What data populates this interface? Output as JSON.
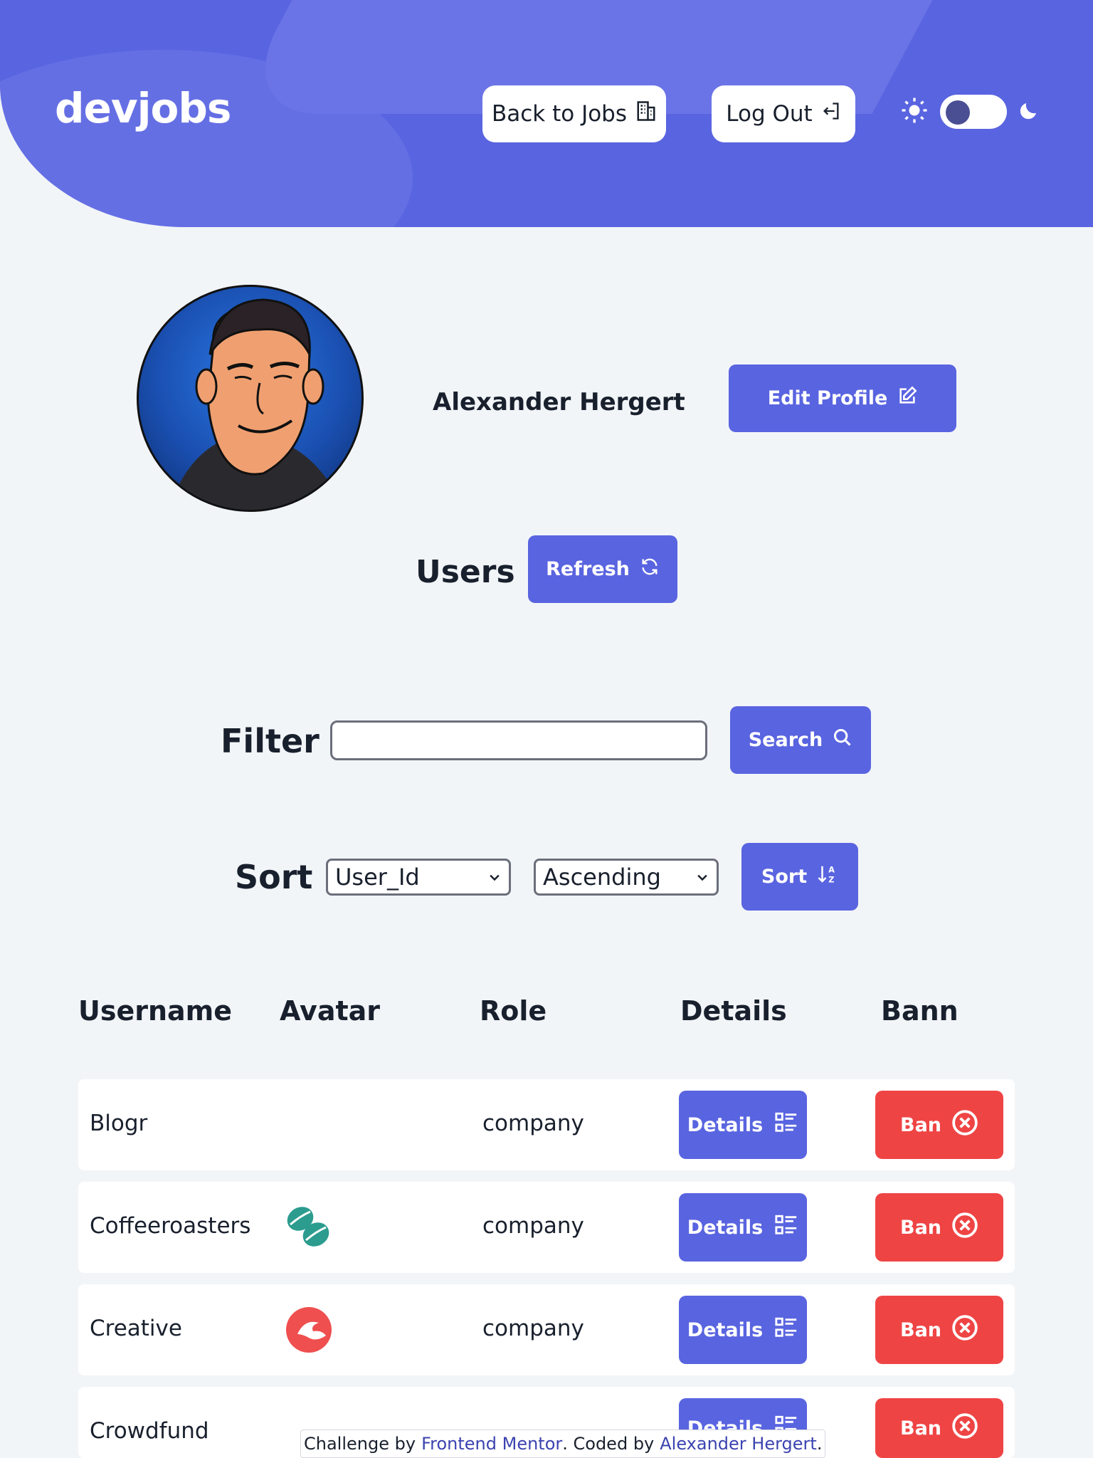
{
  "app": {
    "logo": "devjobs"
  },
  "header": {
    "back_label": "Back to Jobs",
    "back_icon": "building-icon",
    "logout_label": "Log Out",
    "logout_icon": "logout-icon",
    "theme_toggle": {
      "light_icon": "sun-icon",
      "dark_icon": "moon-icon",
      "state": "light"
    }
  },
  "profile": {
    "name": "Alexander Hergert",
    "edit_label": "Edit Profile"
  },
  "users": {
    "title": "Users",
    "refresh_label": "Refresh"
  },
  "filter": {
    "label": "Filter",
    "value": "",
    "search_label": "Search"
  },
  "sort": {
    "label": "Sort",
    "field": "User_Id",
    "direction": "Ascending",
    "button_label": "Sort"
  },
  "table": {
    "headers": [
      "Username",
      "Avatar",
      "Role",
      "Details",
      "Bann"
    ],
    "details_label": "Details",
    "ban_label": "Ban",
    "rows": [
      {
        "username": "Blogr",
        "avatar": "",
        "role": "company"
      },
      {
        "username": "Coffeeroasters",
        "avatar": "coffee-beans-logo",
        "role": "company"
      },
      {
        "username": "Creative",
        "avatar": "creative-wave-logo",
        "role": "company"
      },
      {
        "username": "Crowdfund",
        "avatar": "",
        "role": ""
      }
    ]
  },
  "footer": {
    "challenge_text": "Challenge by",
    "mentor_link": "Frontend Mentor",
    "coded_text": ". Coded by",
    "author_link": "Alexander Hergert",
    "end": "."
  },
  "colors": {
    "primary": "#5964e0",
    "danger": "#ef4444",
    "background": "#f2f5f8"
  }
}
